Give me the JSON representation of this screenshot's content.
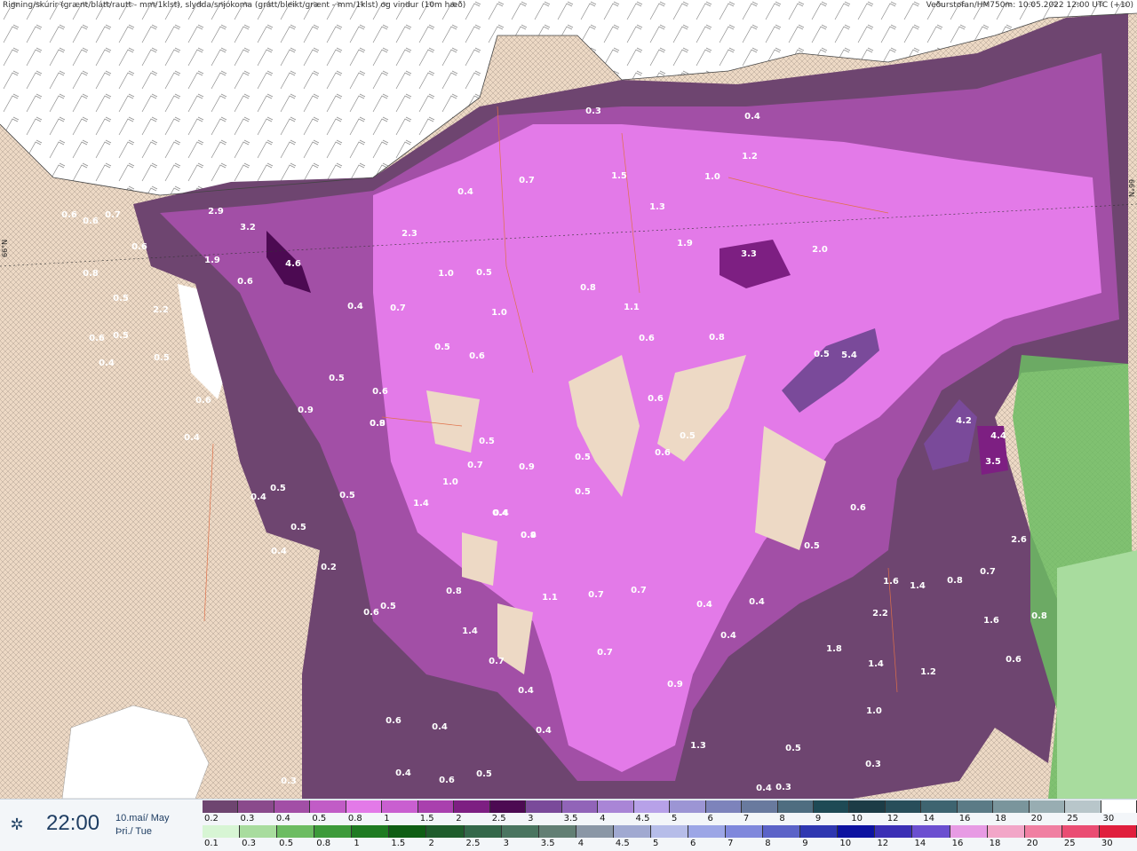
{
  "header": {
    "left": "Rigning/skúrir (grænt/blátt/rautt - mm/1klst), slydda/snjókoma (grátt/bleikt/grænt - mm/1klst) og vindur (10m hæð)",
    "right": "Veðurstofan/HM750m: 10.05.2022 12:00 UTC (+10)"
  },
  "lat_left": "66°N",
  "lat_right": "66°N",
  "footer": {
    "time": "22:00",
    "date_line1": "10.maí/ May",
    "date_line2": "Þri./ Tue",
    "icon": "sun-icon"
  },
  "rain_scale": {
    "labels": [
      "0.2",
      "0.3",
      "0.4",
      "0.5",
      "0.8",
      "1",
      "1.5",
      "2",
      "2.5",
      "3",
      "3.5",
      "4",
      "4.5",
      "5",
      "6",
      "7",
      "8",
      "9",
      "10",
      "12",
      "14",
      "16",
      "18",
      "20",
      "25",
      "30"
    ],
    "colors": [
      "#6e4570",
      "#8a4a8c",
      "#a24fa6",
      "#c15cc6",
      "#e37ae8",
      "#c95fd0",
      "#a940ae",
      "#7d1f82",
      "#4c0a52",
      "#7a4a9a",
      "#9164b8",
      "#a985d6",
      "#b7a1e8",
      "#9c95d4",
      "#7d83bb",
      "#697a9e",
      "#4e6d80",
      "#1e4a55",
      "#1c3c46",
      "#284e5a",
      "#3e6470",
      "#5b7b86",
      "#7a959c",
      "#98adb2",
      "#b8c6ca",
      "#ffffff"
    ]
  },
  "snow_scale": {
    "labels": [
      "0.1",
      "0.3",
      "0.5",
      "0.8",
      "1",
      "1.5",
      "2",
      "2.5",
      "3",
      "3.5",
      "4",
      "4.5",
      "5",
      "6",
      "7",
      "8",
      "9",
      "10",
      "12",
      "14",
      "16",
      "18",
      "20",
      "25",
      "30"
    ],
    "colors": [
      "#d7f5d4",
      "#a8dc9e",
      "#6cbc62",
      "#3d9a3a",
      "#1f7b22",
      "#0f5e14",
      "#1f5d2c",
      "#34684a",
      "#4a7560",
      "#627f74",
      "#8a97a6",
      "#a0a9d1",
      "#b6bde9",
      "#9ca6e6",
      "#7f88dc",
      "#5b63c8",
      "#2f37b1",
      "#0d12a0",
      "#3b2fb5",
      "#6b4fd0",
      "#e79be4",
      "#f2a6c8",
      "#f07fa2",
      "#ea4d73",
      "#e01f3d"
    ]
  },
  "map_values": [
    "0.3",
    "0.4",
    "0.4",
    "0.6",
    "0.6",
    "0.7",
    "0.6",
    "0.8",
    "0.5",
    "2.9",
    "3.2",
    "4.6",
    "1.9",
    "0.6",
    "2.2",
    "0.6",
    "0.5",
    "0.4",
    "0.5",
    "0.6",
    "0.4",
    "0.5",
    "0.4",
    "0.5",
    "0.9",
    "0.5",
    "0.6",
    "0.4",
    "0.2",
    "0.5",
    "2.3",
    "0.7",
    "0.9",
    "1.5",
    "1.3",
    "1.0",
    "1.2",
    "0.4",
    "1.0",
    "0.5",
    "1.9",
    "3.3",
    "2.0",
    "0.7",
    "0.8",
    "1.1",
    "1.0",
    "0.5",
    "0.6",
    "0.6",
    "0.8",
    "0.6",
    "0.5",
    "5.4",
    "0.8",
    "0.9",
    "0.5",
    "0.7",
    "0.4",
    "4.2",
    "4.4",
    "3.5",
    "0.6",
    "0.5",
    "1.0",
    "0.5",
    "1.4",
    "0.4",
    "0.4",
    "0.5",
    "0.6",
    "0.9",
    "0.5",
    "2.6",
    "0.5",
    "0.6",
    "1.6",
    "1.4",
    "0.8",
    "0.7",
    "0.8",
    "1.1",
    "0.7",
    "0.7",
    "0.4",
    "0.4",
    "2.2",
    "1.6",
    "0.8",
    "1.4",
    "0.7",
    "0.7",
    "0.4",
    "1.8",
    "1.4",
    "1.2",
    "0.4",
    "0.9",
    "0.6",
    "0.4",
    "0.4",
    "1.3",
    "0.5",
    "1.0",
    "0.6",
    "0.5",
    "0.6",
    "0.3",
    "0.3",
    "0.4",
    "0.4",
    "0.3"
  ]
}
